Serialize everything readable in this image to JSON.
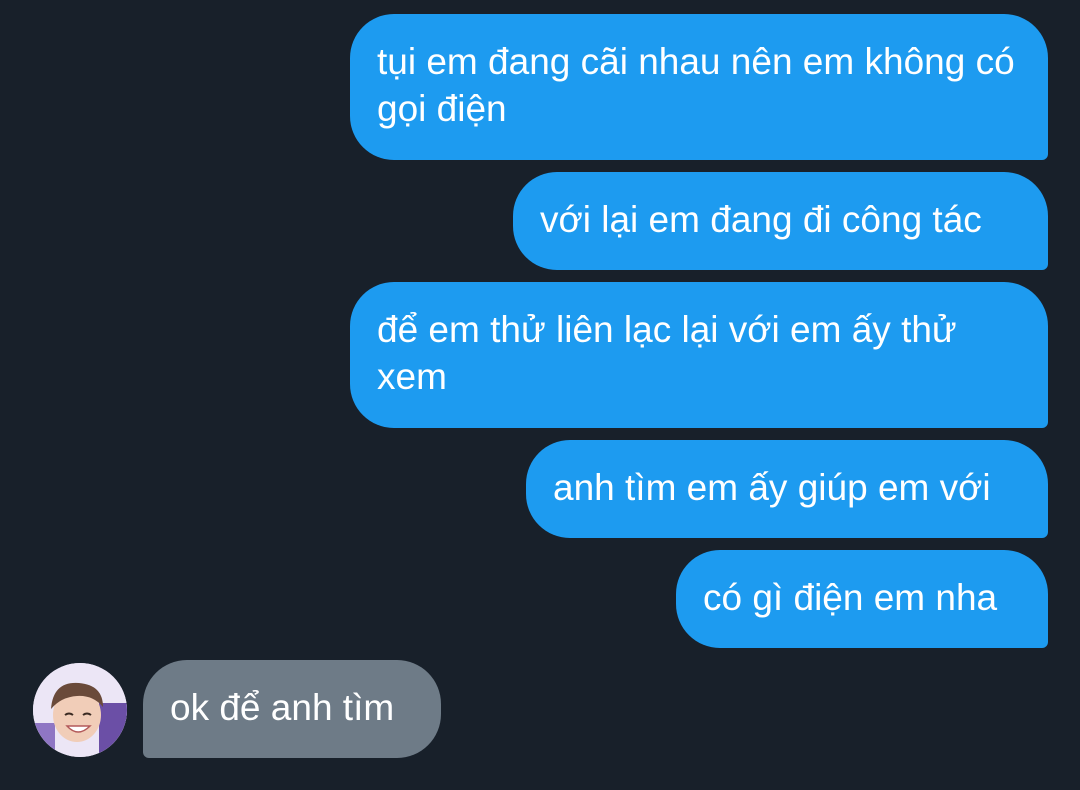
{
  "messages": [
    {
      "from": "me",
      "text": "tụi em đang cãi nhau nên em không có gọi điện"
    },
    {
      "from": "me",
      "text": "với lại em đang đi công tác"
    },
    {
      "from": "me",
      "text": "để em thử liên lạc lại với em ấy thử xem"
    },
    {
      "from": "me",
      "text": "anh tìm em ấy giúp em với"
    },
    {
      "from": "me",
      "text": "có gì điện em nha"
    },
    {
      "from": "other",
      "text": "ok để anh tìm"
    }
  ],
  "colors": {
    "background": "#18202a",
    "sent_bubble": "#1d9bf0",
    "received_bubble": "#6e7b87",
    "text": "#ffffff"
  },
  "avatar": {
    "icon": "profile-photo-icon"
  }
}
